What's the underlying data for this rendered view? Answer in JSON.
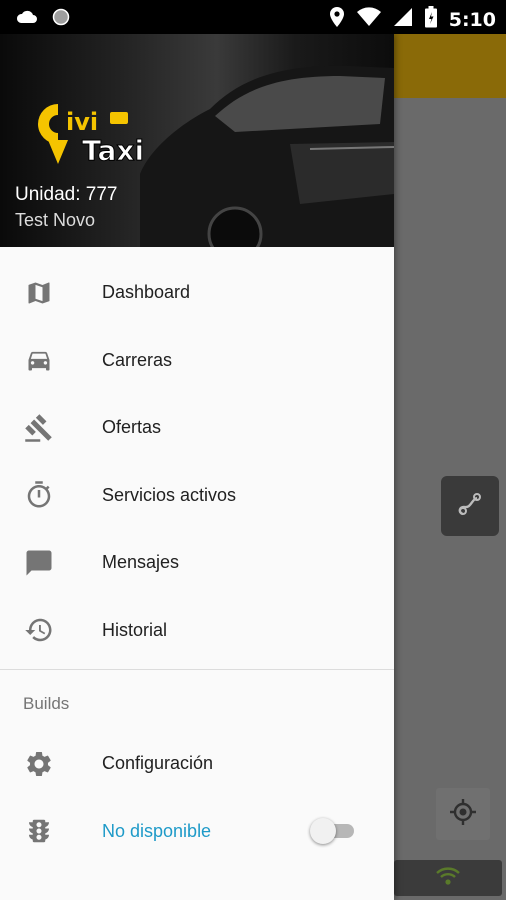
{
  "status_bar": {
    "time": "5:10",
    "icons": [
      "cloud-icon",
      "circle-notification-icon",
      "location-pin-icon",
      "wifi-icon",
      "signal-icon",
      "battery-icon"
    ]
  },
  "drawer": {
    "header": {
      "logo_text_top": "ivi",
      "logo_text_bottom": "Taxi",
      "unit": "Unidad: 777",
      "name": "Test Novo"
    },
    "items": [
      {
        "label": "Dashboard",
        "icon": "map-icon"
      },
      {
        "label": "Carreras",
        "icon": "car-icon"
      },
      {
        "label": "Ofertas",
        "icon": "gavel-icon"
      },
      {
        "label": "Servicios activos",
        "icon": "timer-icon"
      },
      {
        "label": "Mensajes",
        "icon": "message-icon"
      },
      {
        "label": "Historial",
        "icon": "history-icon"
      }
    ],
    "section_title": "Builds",
    "section_items": [
      {
        "label": "Configuración",
        "icon": "gear-icon"
      },
      {
        "label": "No disponible",
        "icon": "traffic-light-icon",
        "toggle": false
      }
    ]
  },
  "colors": {
    "accent": "#1e9ac8",
    "toolbar": "#f5b800",
    "logo_yellow": "#f5c400"
  }
}
